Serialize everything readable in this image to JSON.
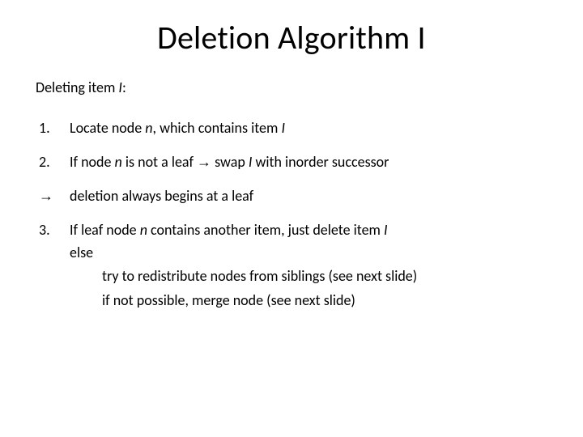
{
  "title": "Deletion Algorithm I",
  "intro_prefix": "Deleting item ",
  "intro_item": "I",
  "intro_suffix": ":",
  "steps": [
    {
      "n": "1.",
      "t1": "Locate node ",
      "i1": "n",
      "t2": ", which contains item ",
      "i2": "I",
      "t3": ""
    },
    {
      "n": "2.",
      "t1": "If node ",
      "i1": "n",
      "t2": " is not a leaf ",
      "ar": "→",
      "t3": " swap ",
      "i2": "I",
      "t4": " with inorder successor"
    },
    {
      "n": "→",
      "t1": "deletion always begins at a leaf"
    },
    {
      "n": "3.",
      "t1": "If leaf node ",
      "i1": "n",
      "t2": " contains another item, just delete item ",
      "i2": "I",
      "else": "else",
      "sub1": "try to redistribute nodes from siblings (see next slide)",
      "sub2": "if not possible, merge node (see next slide)"
    }
  ]
}
